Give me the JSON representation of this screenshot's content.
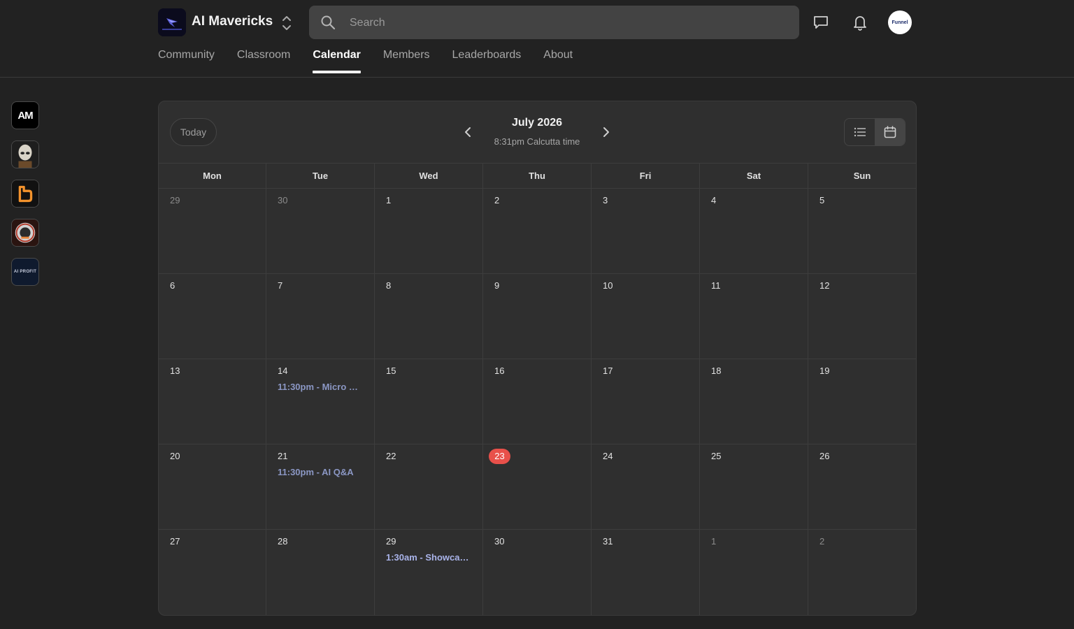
{
  "header": {
    "group_name": "AI Mavericks",
    "search_placeholder": "Search",
    "avatar_text": "Funnel"
  },
  "tabs": [
    {
      "label": "Community"
    },
    {
      "label": "Classroom"
    },
    {
      "label": "Calendar",
      "active": true
    },
    {
      "label": "Members"
    },
    {
      "label": "Leaderboards"
    },
    {
      "label": "About"
    }
  ],
  "sidebar": {
    "groups": [
      {
        "icon": "am-logo-icon",
        "text": "AM"
      },
      {
        "icon": "alien-logo-icon"
      },
      {
        "icon": "orange-b-logo-icon"
      },
      {
        "icon": "emblem-logo-icon"
      },
      {
        "icon": "ai-profit-logo-icon",
        "text": "AI PROFIT"
      }
    ]
  },
  "calendar": {
    "today_label": "Today",
    "month_title": "July 2026",
    "time_subtitle": "8:31pm Calcutta time",
    "weekdays": [
      "Mon",
      "Tue",
      "Wed",
      "Thu",
      "Fri",
      "Sat",
      "Sun"
    ],
    "weeks": [
      [
        {
          "n": "29",
          "other": true
        },
        {
          "n": "30",
          "other": true
        },
        {
          "n": "1"
        },
        {
          "n": "2"
        },
        {
          "n": "3"
        },
        {
          "n": "4"
        },
        {
          "n": "5"
        }
      ],
      [
        {
          "n": "6"
        },
        {
          "n": "7"
        },
        {
          "n": "8"
        },
        {
          "n": "9"
        },
        {
          "n": "10"
        },
        {
          "n": "11"
        },
        {
          "n": "12"
        }
      ],
      [
        {
          "n": "13"
        },
        {
          "n": "14",
          "event": "11:30pm - Micro S…"
        },
        {
          "n": "15"
        },
        {
          "n": "16"
        },
        {
          "n": "17"
        },
        {
          "n": "18"
        },
        {
          "n": "19"
        }
      ],
      [
        {
          "n": "20"
        },
        {
          "n": "21",
          "event": "11:30pm - AI Q&A"
        },
        {
          "n": "22"
        },
        {
          "n": "23",
          "today": true
        },
        {
          "n": "24"
        },
        {
          "n": "25"
        },
        {
          "n": "26"
        }
      ],
      [
        {
          "n": "27"
        },
        {
          "n": "28"
        },
        {
          "n": "29",
          "event": "1:30am - Showcas…",
          "bright": true
        },
        {
          "n": "30"
        },
        {
          "n": "31"
        },
        {
          "n": "1",
          "other": true
        },
        {
          "n": "2",
          "other": true
        }
      ]
    ],
    "today_color": "#e8504a",
    "event_color": "#8b97c4"
  }
}
